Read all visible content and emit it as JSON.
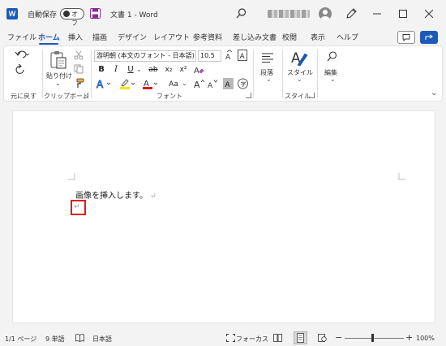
{
  "titlebar": {
    "app_icon_letter": "W",
    "autosave_label": "自動保存",
    "autosave_state": "オフ",
    "doc_title": "文書 1  -  Word"
  },
  "tabs": [
    {
      "label": "ファイル"
    },
    {
      "label": "ホーム",
      "active": true
    },
    {
      "label": "挿入"
    },
    {
      "label": "描画"
    },
    {
      "label": "デザイン"
    },
    {
      "label": "レイアウト"
    },
    {
      "label": "参考資料"
    },
    {
      "label": "差し込み文書"
    },
    {
      "label": "校閲"
    },
    {
      "label": "表示"
    },
    {
      "label": "ヘルプ"
    }
  ],
  "ribbon": {
    "undo": {
      "group_label": "元に戻す"
    },
    "clipboard": {
      "paste_label": "貼り付け",
      "group_label": "クリップボード"
    },
    "font": {
      "font_name": "游明朝 (本文のフォント - 日本語)",
      "font_size": "10.5",
      "group_label": "フォント",
      "bold": "B",
      "italic": "I",
      "underline": "U",
      "strike": "ab",
      "subscript": "x₂",
      "superscript": "x²",
      "case": "Aa"
    },
    "paragraph": {
      "label": "段落"
    },
    "styles": {
      "label": "スタイル",
      "group_label": "スタイル"
    },
    "editing": {
      "label": "編集"
    }
  },
  "document": {
    "line1": "画像を挿入します。",
    "para_mark": "↵"
  },
  "statusbar": {
    "page": "1/1 ページ",
    "words": "9 単語",
    "language": "日本語",
    "focus": "フォーカス",
    "zoom": "100%"
  },
  "colors": {
    "accent": "#1e5ab8",
    "highlight_marker": "#e01b1b",
    "highlighter_yellow": "#f5e50a",
    "font_color_red": "#d81b1b"
  },
  "icons": [
    "word-logo-icon",
    "save-icon",
    "search-icon",
    "pen-icon",
    "undo-icon",
    "redo-icon",
    "paste-icon",
    "cut-icon",
    "copy-icon",
    "format-painter-icon",
    "paragraph-icon",
    "styles-icon",
    "editing-icon",
    "comment-icon",
    "share-icon",
    "read-mode-icon",
    "print-layout-icon",
    "web-layout-icon",
    "zoom-slider"
  ]
}
